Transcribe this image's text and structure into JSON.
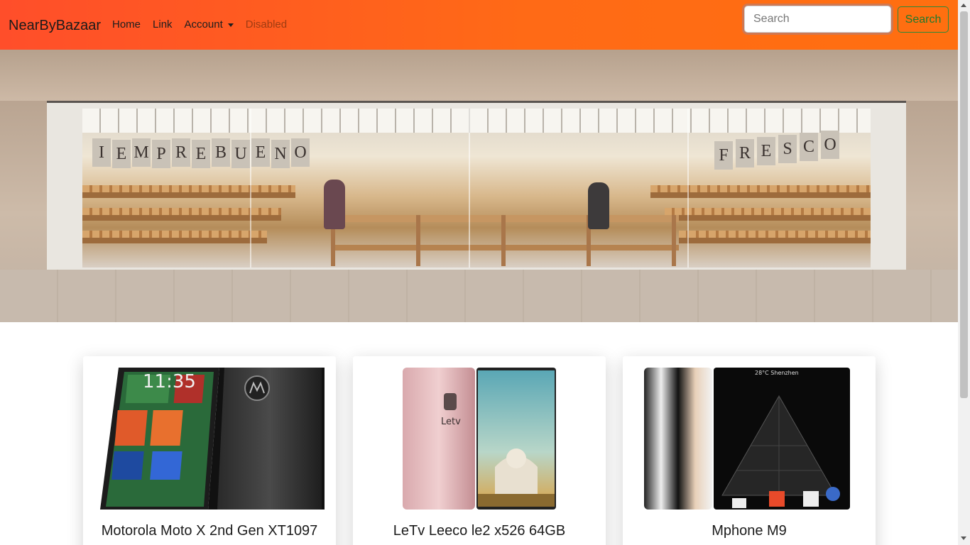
{
  "navbar": {
    "brand": "NearByBazaar",
    "links": [
      {
        "label": "Home"
      },
      {
        "label": "Link"
      },
      {
        "label": "Account",
        "dropdown": true
      },
      {
        "label": "Disabled",
        "disabled": true
      }
    ],
    "search": {
      "placeholder": "Search",
      "value": ""
    },
    "search_button": "Search",
    "colors": {
      "gradient_start": "#ff4e2a",
      "gradient_end": "#ff6f10",
      "search_button": "#1d7a2e"
    }
  },
  "hero": {
    "signage_top": [
      "I",
      "E",
      "M",
      "P",
      "R",
      "E",
      "B",
      "U",
      "E",
      "N",
      "O"
    ],
    "signage_right": [
      "F",
      "R",
      "E",
      "S",
      "C",
      "O"
    ]
  },
  "products": [
    {
      "title": "Motorola Moto X 2nd Gen XT1097",
      "image_text": "11:35"
    },
    {
      "title": "LeTv Leeco le2 x526 64GB",
      "image_text": "Letv"
    },
    {
      "title": "Mphone M9",
      "image_text": "28°C   Shenzhen"
    }
  ]
}
